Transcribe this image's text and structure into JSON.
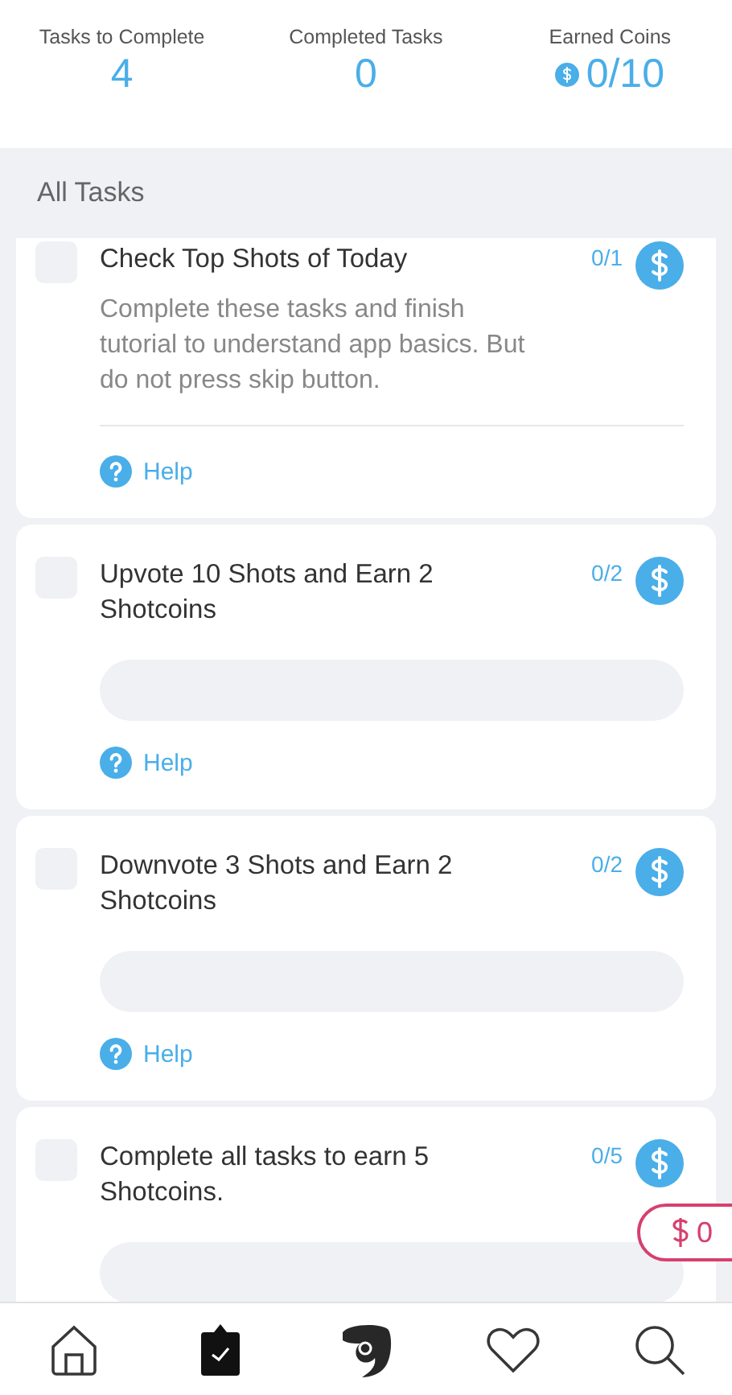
{
  "stats": [
    {
      "label": "Tasks to Complete",
      "value": "4",
      "coin": false
    },
    {
      "label": "Completed Tasks",
      "value": "0",
      "coin": false
    },
    {
      "label": "Earned Coins",
      "value": "0/10",
      "coin": true
    }
  ],
  "section_title": "All Tasks",
  "tasks": [
    {
      "kind": "description",
      "title": "Check Top Shots of Today",
      "description": "Complete these tasks and finish tutorial to understand app basics. But do not press skip button.",
      "progress": "0/1",
      "checked": false,
      "help": "Help"
    },
    {
      "kind": "progress",
      "title": "Upvote 10 Shots and Earn 2 Shotcoins",
      "progress": "0/2",
      "checked": false,
      "help": "Help"
    },
    {
      "kind": "progress",
      "title": "Downvote 3 Shots and Earn 2 Shotcoins",
      "progress": "0/2",
      "checked": false,
      "help": "Help"
    },
    {
      "kind": "progress",
      "title": "Complete all tasks to earn 5 Shotcoins.",
      "progress": "0/5",
      "checked": false
    }
  ],
  "balance": "0",
  "tabs": [
    {
      "kind": "home",
      "selected": false
    },
    {
      "kind": "tasks",
      "selected": true
    },
    {
      "kind": "logo",
      "selected": false
    },
    {
      "kind": "heart",
      "selected": false
    },
    {
      "kind": "search",
      "selected": false
    }
  ]
}
